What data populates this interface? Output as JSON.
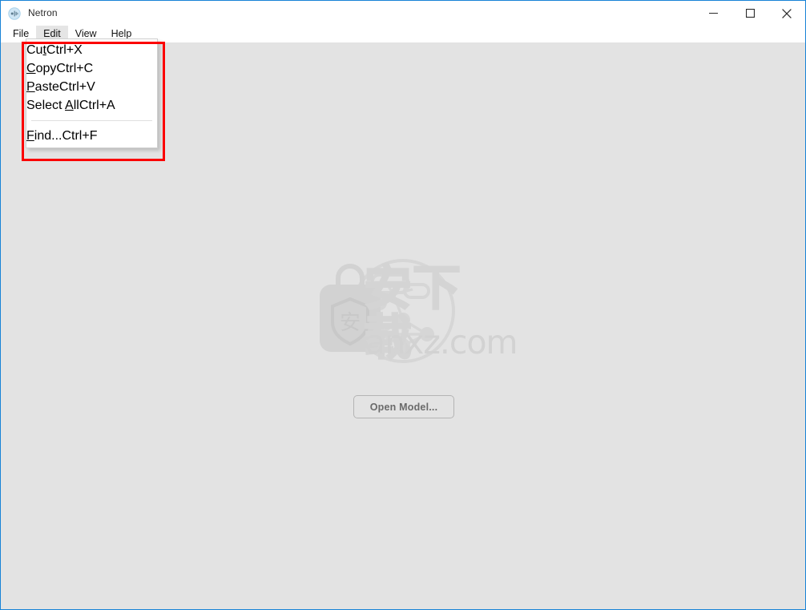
{
  "window": {
    "title": "Netron",
    "app_icon": "netron-app-icon",
    "accent_color": "#1883d7",
    "client_background": "#e3e3e3",
    "controls": [
      {
        "name": "minimize",
        "glyph": "minimize-icon"
      },
      {
        "name": "maximize",
        "glyph": "maximize-icon"
      },
      {
        "name": "close",
        "glyph": "close-icon"
      }
    ]
  },
  "menubar": {
    "items": [
      {
        "label": "File",
        "active": false
      },
      {
        "label": "Edit",
        "active": true
      },
      {
        "label": "View",
        "active": false
      },
      {
        "label": "Help",
        "active": false
      }
    ]
  },
  "edit_menu": {
    "open": true,
    "items": [
      {
        "label_pre": "Cu",
        "label_key": "t",
        "label_post": "",
        "accel": "Ctrl+X"
      },
      {
        "label_pre": "",
        "label_key": "C",
        "label_post": "opy",
        "accel": "Ctrl+C"
      },
      {
        "label_pre": "",
        "label_key": "P",
        "label_post": "aste",
        "accel": "Ctrl+V"
      },
      {
        "label_pre": "Select ",
        "label_key": "A",
        "label_post": "ll",
        "accel": "Ctrl+A"
      },
      {
        "separator": true
      },
      {
        "label_pre": "",
        "label_key": "F",
        "label_post": "ind...",
        "accel": "Ctrl+F"
      }
    ]
  },
  "main": {
    "open_model_label": "Open Model...",
    "logo": "netron-graph-logo"
  },
  "annotation": {
    "color": "#fb0000",
    "shape": "rectangle-highlight"
  },
  "watermark": {
    "site": "anxz.com",
    "cjk": "安下载",
    "badge_char": "安",
    "color": "#d2d2d2"
  }
}
